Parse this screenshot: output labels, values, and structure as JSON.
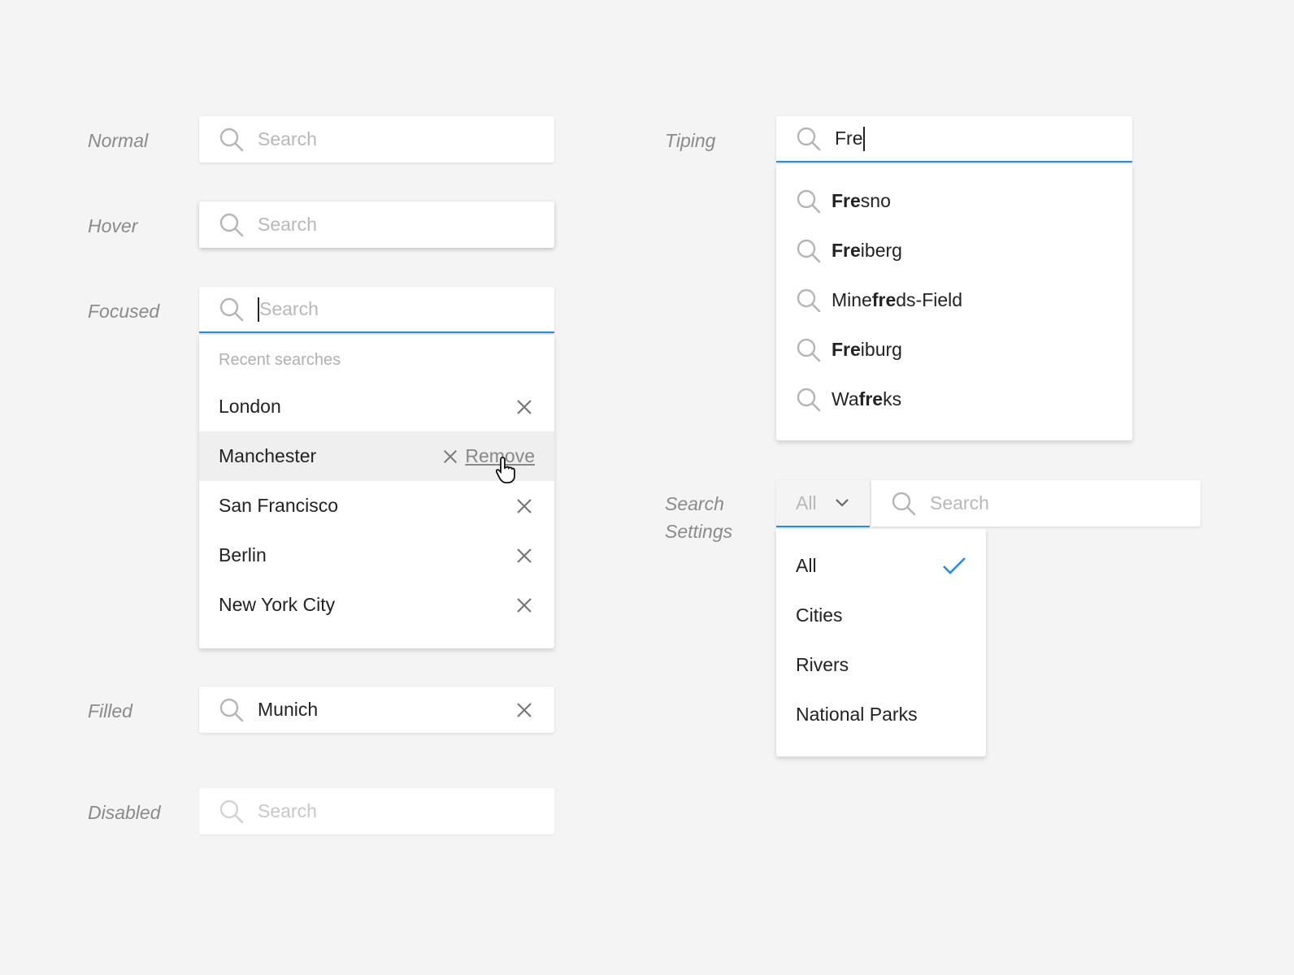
{
  "states": {
    "normal": {
      "label": "Normal",
      "placeholder": "Search"
    },
    "hover": {
      "label": "Hover",
      "placeholder": "Search"
    },
    "focused": {
      "label": "Focused",
      "placeholder": "Search",
      "recent_heading": "Recent searches",
      "recent": [
        "London",
        "Manchester",
        "San Francisco",
        "Berlin",
        "New York City"
      ],
      "remove_label": "Remove"
    },
    "filled": {
      "label": "Filled",
      "value": "Munich"
    },
    "disabled": {
      "label": "Disabled",
      "placeholder": "Search"
    },
    "typing": {
      "label": "Tiping",
      "value": "Fre",
      "suggestions": [
        {
          "pre": "",
          "match": "Fre",
          "post": "sno"
        },
        {
          "pre": "",
          "match": "Fre",
          "post": "iberg"
        },
        {
          "pre": "Mine",
          "match": "fre",
          "post": "ds-Field"
        },
        {
          "pre": "",
          "match": "Fre",
          "post": "iburg"
        },
        {
          "pre": "Wa",
          "match": "fre",
          "post": "ks"
        }
      ]
    },
    "settings": {
      "label_line1": "Search",
      "label_line2": "Settings",
      "selected": "All",
      "placeholder": "Search",
      "options": [
        "All",
        "Cities",
        "Rivers",
        "National Parks"
      ]
    }
  },
  "colors": {
    "accent": "#1f8fe0",
    "background": "#f4f4f4"
  }
}
